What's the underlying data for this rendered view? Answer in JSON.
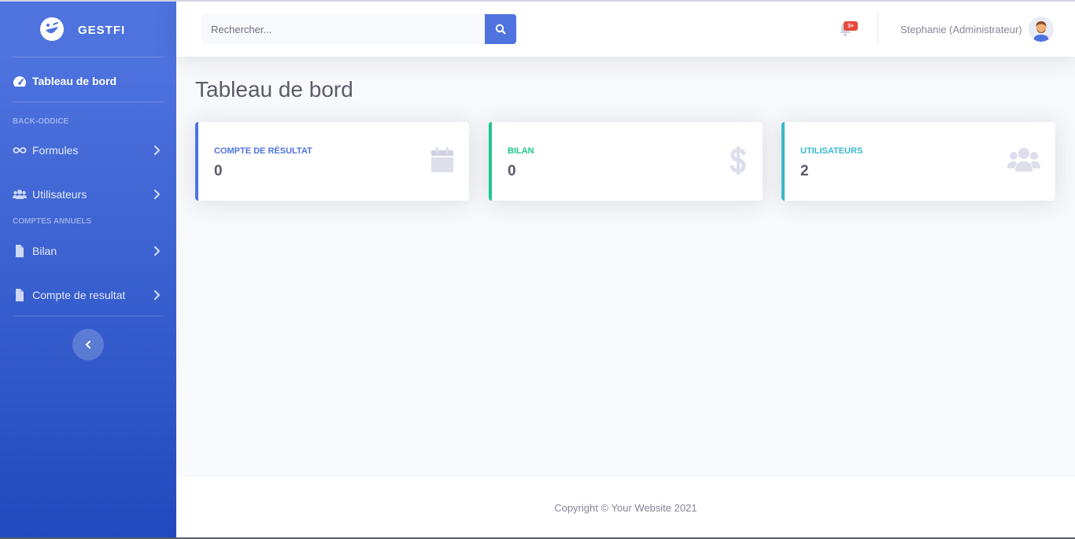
{
  "brand": {
    "name": "GESTFI",
    "logo_icon": "laughing-face-icon"
  },
  "sidebar": {
    "active_item": {
      "label": "Tableau de bord",
      "icon": "tachometer-icon"
    },
    "sections": [
      {
        "heading": "BACK-ODDICE",
        "items": [
          {
            "label": "Formules",
            "icon": "infinity-icon"
          },
          {
            "label": "Utilisateurs",
            "icon": "users-icon"
          }
        ]
      },
      {
        "heading": "COMPTES ANNUELS",
        "items": [
          {
            "label": "Bilan",
            "icon": "file-icon"
          },
          {
            "label": "Compte de resultat",
            "icon": "file-icon"
          }
        ]
      }
    ],
    "toggle_icon": "chevron-left-icon"
  },
  "topbar": {
    "search_placeholder": "Rechercher...",
    "alerts_badge": "3+",
    "user_name": "Stephanie (Administrateur)"
  },
  "page": {
    "title": "Tableau de bord",
    "cards": [
      {
        "title": "COMPTE DE RÉSULTAT",
        "value": "0",
        "icon": "calendar-icon",
        "color": "#4e73df"
      },
      {
        "title": "BILAN",
        "value": "0",
        "icon": "dollar-icon",
        "color": "#1cc88a"
      },
      {
        "title": "UTILISATEURS",
        "value": "2",
        "icon": "users-icon",
        "color": "#36b9cc"
      }
    ]
  },
  "footer": {
    "copyright": "Copyright © Your Website 2021"
  },
  "colors": {
    "primary": "#4e73df",
    "success": "#1cc88a",
    "info": "#36b9cc",
    "danger": "#e74a3b"
  }
}
